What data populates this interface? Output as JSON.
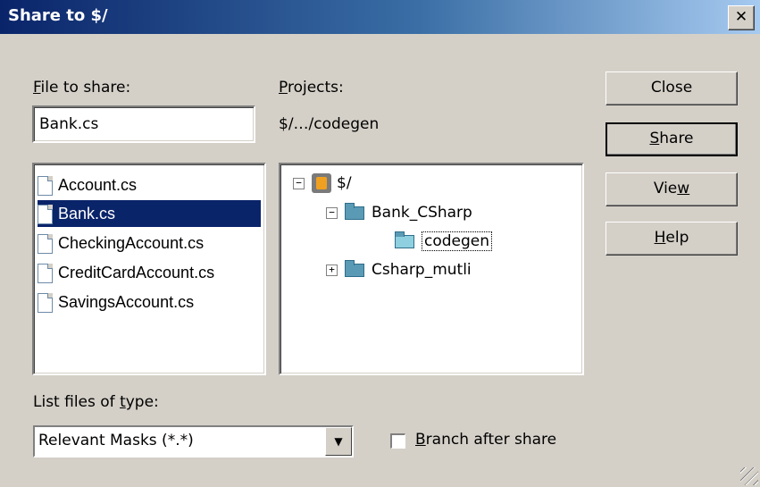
{
  "window": {
    "title": "Share to $/",
    "close_glyph": "✕"
  },
  "file_to_share": {
    "label_pre": "",
    "label_mnemonic": "F",
    "label_post": "ile to share:",
    "value": "Bank.cs"
  },
  "projects": {
    "label_mnemonic": "P",
    "label_post": "rojects:",
    "path": "$/…/codegen"
  },
  "files": [
    {
      "name": "Account.cs",
      "selected": false
    },
    {
      "name": "Bank.cs",
      "selected": true
    },
    {
      "name": "CheckingAccount.cs",
      "selected": false
    },
    {
      "name": "CreditCardAccount.cs",
      "selected": false
    },
    {
      "name": "SavingsAccount.cs",
      "selected": false
    }
  ],
  "tree": {
    "root": {
      "label": "$/",
      "expander": "−"
    },
    "bank": {
      "label": "Bank_CSharp",
      "expander": "−"
    },
    "codegen": {
      "label": "codegen"
    },
    "csharp": {
      "label": "Csharp_mutli",
      "expander": "+"
    }
  },
  "buttons": {
    "close": {
      "label": "Close"
    },
    "share": {
      "mnemonic": "S",
      "rest": "hare"
    },
    "view": {
      "pre": "Vie",
      "mnemonic": "w"
    },
    "help": {
      "mnemonic": "H",
      "rest": "elp"
    }
  },
  "file_type": {
    "label_pre": "List files of ",
    "label_mnemonic": "t",
    "label_post": "ype:",
    "value": "Relevant Masks (*.*)",
    "arrow": "▼"
  },
  "branch": {
    "mnemonic": "B",
    "rest": "ranch after share",
    "checked": false
  }
}
